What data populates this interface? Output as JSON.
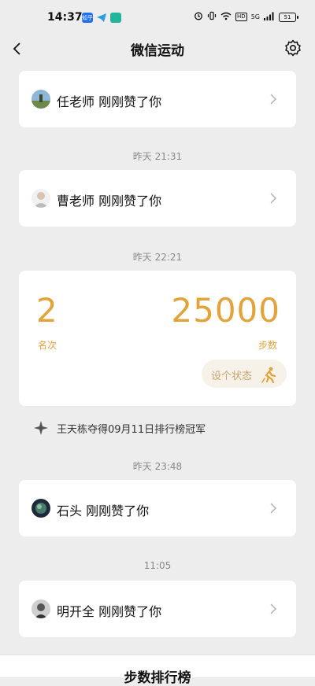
{
  "status_bar": {
    "time": "14:37",
    "app_icons": [
      {
        "name": "zhihu-icon",
        "label": "知乎",
        "color": "#1e6ff1"
      },
      {
        "name": "telegram-icon",
        "label": "",
        "color": "#2a9fe0"
      },
      {
        "name": "chat-app-icon",
        "label": "",
        "color": "#22b59b"
      }
    ],
    "hd_badge": "HD",
    "signal_label": "5G",
    "battery": "51"
  },
  "header": {
    "title": "微信运动"
  },
  "likes": [
    {
      "message": "任老师 刚刚赞了你"
    },
    {
      "message": "曹老师 刚刚赞了你"
    }
  ],
  "timestamps": [
    "昨天 21:31",
    "昨天 22:21",
    "昨天 23:48",
    "11:05"
  ],
  "rank_card": {
    "rank": "2",
    "rank_label": "名次",
    "steps": "25000",
    "steps_label": "步数",
    "status_button": "设个状态",
    "accent": "#e3a33b"
  },
  "champion": {
    "text": "王天栋夺得09月11日排行榜冠军"
  },
  "likes_later": [
    {
      "message": "石头 刚刚赞了你"
    },
    {
      "message": "明开全 刚刚赞了你"
    }
  ],
  "bottom": {
    "label": "步数排行榜"
  }
}
